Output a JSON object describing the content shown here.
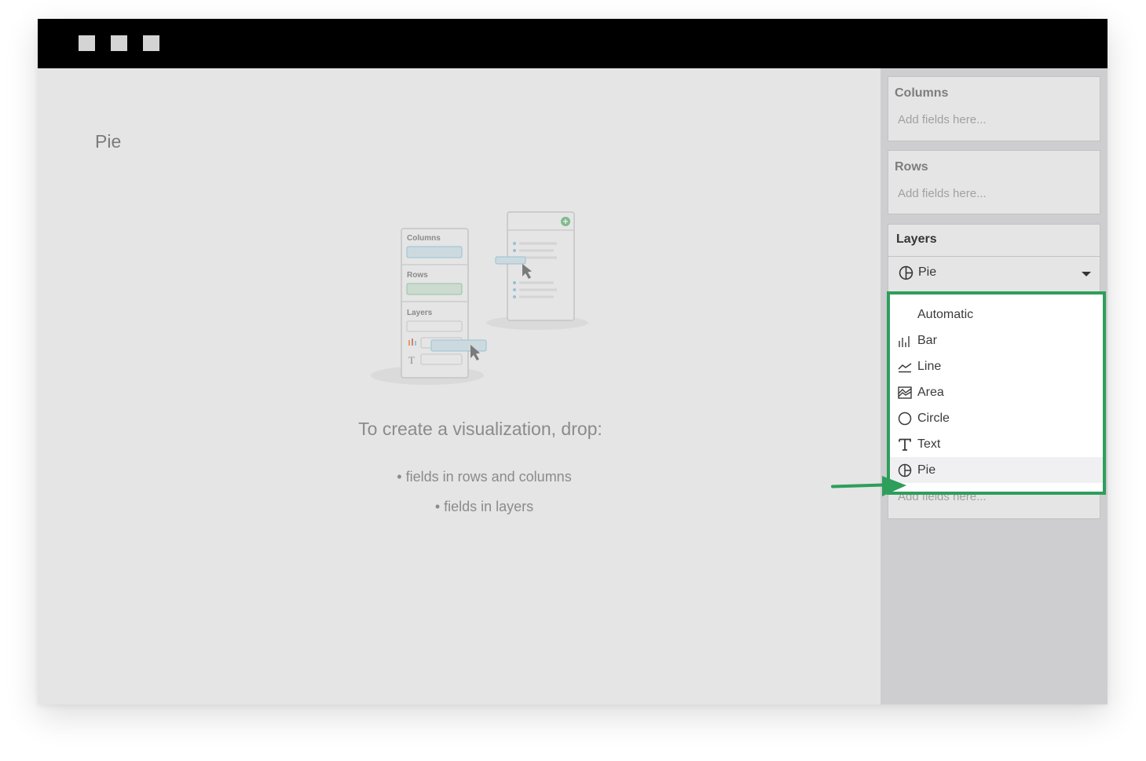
{
  "visualization": {
    "title": "Pie"
  },
  "illustration": {
    "columns_label": "Columns",
    "rows_label": "Rows",
    "layers_label": "Layers",
    "text_glyph": "T"
  },
  "empty_state": {
    "title": "To create a visualization, drop:",
    "line1": "• fields in rows and columns",
    "line2": "• fields in layers"
  },
  "sidebar": {
    "columns": {
      "title": "Columns",
      "placeholder": "Add fields here..."
    },
    "rows": {
      "title": "Rows",
      "placeholder": "Add fields here..."
    },
    "layers": {
      "title": "Layers",
      "selected": "Pie",
      "selected_icon": "pie-icon",
      "placeholder": "Add fields here..."
    }
  },
  "dropdown": {
    "options": [
      {
        "label": "Automatic",
        "icon": ""
      },
      {
        "label": "Bar",
        "icon": "bar-chart-icon"
      },
      {
        "label": "Line",
        "icon": "line-chart-icon"
      },
      {
        "label": "Area",
        "icon": "area-chart-icon"
      },
      {
        "label": "Circle",
        "icon": "circle-icon"
      },
      {
        "label": "Text",
        "icon": "text-icon"
      },
      {
        "label": "Pie",
        "icon": "pie-icon",
        "selected": true
      }
    ]
  },
  "colors": {
    "highlight_border": "#2e9e5b",
    "arrow": "#2e9e5b",
    "titlebar": "#000000"
  }
}
